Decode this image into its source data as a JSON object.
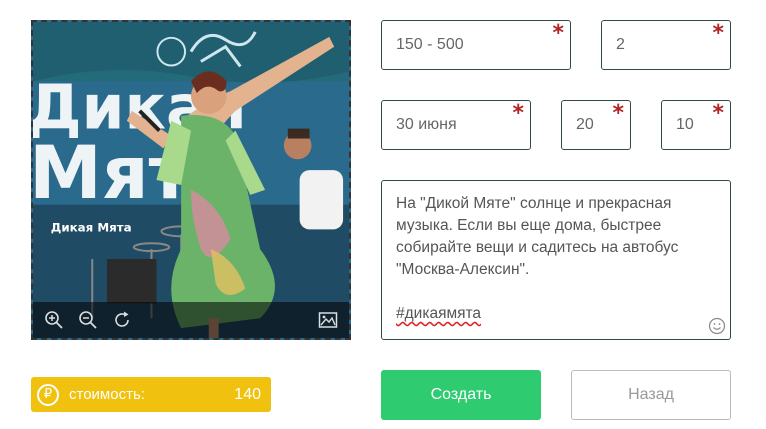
{
  "form": {
    "range_value": "150 - 500",
    "count_value": "2",
    "date_value": "30 июня",
    "hour_value": "20",
    "minute_value": "10",
    "required_mark": "*",
    "description_lines": [
      "На \"Дикой Мяте\" солнце и прекрасная",
      "музыка. Если вы еще дома, быстрее",
      "собирайте вещи и садитесь на автобус",
      "\"Москва-Алексин\"."
    ],
    "hashtag": "#дикаямята"
  },
  "photo": {
    "banner_text_1": "Дикая",
    "banner_text_2": "Мята",
    "sign_text": "Дикая Мята",
    "toolbar_icons": [
      "zoom-in-icon",
      "zoom-out-icon",
      "rotate-icon",
      "image-icon"
    ]
  },
  "price": {
    "currency_symbol": "₽",
    "label": "стоимость:",
    "value": "140"
  },
  "buttons": {
    "create_label": "Создать",
    "back_label": "Назад"
  },
  "colors": {
    "accent_green": "#2ecb71",
    "price_yellow": "#f0c20f",
    "required_red": "#b12222"
  }
}
